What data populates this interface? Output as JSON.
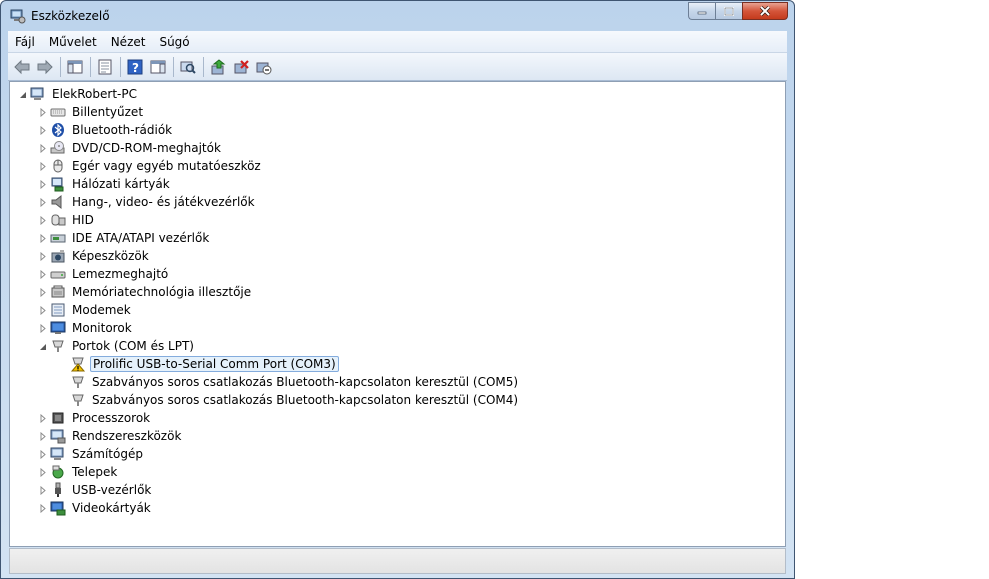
{
  "window": {
    "title": "Eszközkezelő"
  },
  "menu": [
    "Fájl",
    "Művelet",
    "Nézet",
    "Súgó"
  ],
  "toolbar": [
    "back-arrow-icon",
    "forward-arrow-icon",
    "show-hide-console-icon",
    "properties-icon",
    "help-icon",
    "show-action-pane-icon",
    "scan-hardware-icon",
    "update-driver-icon",
    "uninstall-icon",
    "disable-device-icon"
  ],
  "tree": {
    "root": "ElekRobert-PC",
    "categories": [
      {
        "label": "Billentyűzet",
        "icon": "keyboard-icon"
      },
      {
        "label": "Bluetooth-rádiók",
        "icon": "bluetooth-icon"
      },
      {
        "label": "DVD/CD-ROM-meghajtók",
        "icon": "dvd-drive-icon"
      },
      {
        "label": "Egér vagy egyéb mutatóeszköz",
        "icon": "mouse-icon"
      },
      {
        "label": "Hálózati kártyák",
        "icon": "network-card-icon"
      },
      {
        "label": "Hang-, video- és játékvezérlők",
        "icon": "speaker-icon"
      },
      {
        "label": "HID",
        "icon": "hid-icon"
      },
      {
        "label": "IDE ATA/ATAPI vezérlők",
        "icon": "ide-controller-icon"
      },
      {
        "label": "Képeszközök",
        "icon": "camera-icon"
      },
      {
        "label": "Lemezmeghajtó",
        "icon": "disk-drive-icon"
      },
      {
        "label": "Memóriatechnológia illesztője",
        "icon": "memory-card-icon"
      },
      {
        "label": "Modemek",
        "icon": "modem-icon"
      },
      {
        "label": "Monitorok",
        "icon": "monitor-icon"
      },
      {
        "label": "Portok (COM és LPT)",
        "icon": "port-icon",
        "expanded": true,
        "children": [
          {
            "label": "Prolific USB-to-Serial Comm Port (COM3)",
            "icon": "port-warning-icon",
            "selected": true
          },
          {
            "label": "Szabványos soros csatlakozás Bluetooth-kapcsolaton keresztül (COM5)",
            "icon": "port-icon"
          },
          {
            "label": "Szabványos soros csatlakozás Bluetooth-kapcsolaton keresztül (COM4)",
            "icon": "port-icon"
          }
        ]
      },
      {
        "label": "Processzorok",
        "icon": "processor-icon"
      },
      {
        "label": "Rendszereszközök",
        "icon": "system-device-icon"
      },
      {
        "label": "Számítógép",
        "icon": "computer-icon"
      },
      {
        "label": "Telepek",
        "icon": "battery-icon"
      },
      {
        "label": "USB-vezérlők",
        "icon": "usb-icon"
      },
      {
        "label": "Videokártyák",
        "icon": "display-adapter-icon"
      }
    ]
  },
  "colors": {
    "selection": "#e5f1fb",
    "selection_border": "#84acdd",
    "warning": "#f2c200"
  }
}
